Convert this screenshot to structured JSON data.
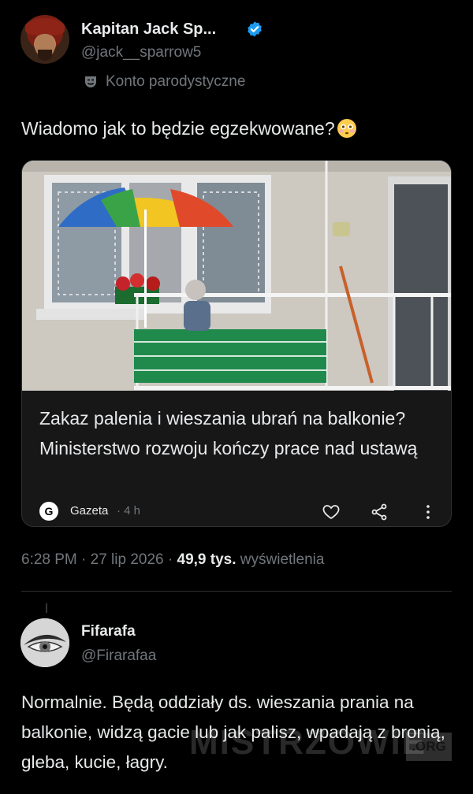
{
  "tweet": {
    "author_name": "Kapitan Jack Sp...",
    "author_handle": "@jack__sparrow5",
    "parody_label": "Konto parodystyczne",
    "text": "Wiadomo jak to będzie egzekwowane?",
    "emoji": "flushed-face-emoji",
    "timestamp": "6:28 PM · 27 lip 2026 · ",
    "views_count": "49,9 tys.",
    "views_label": " wyświetlenia"
  },
  "card": {
    "title": "Zakaz palenia i wieszania ubrań na balkonie? Ministerstwo rozwoju kończy prace nad ustawą",
    "source_logo": "G",
    "source_name": "Gazeta",
    "source_time": " · 4 h",
    "icons": [
      "heart-icon",
      "share-icon",
      "more-icon"
    ]
  },
  "reply": {
    "author_name": "Fifarafa",
    "author_handle": "@Firarafaa",
    "text": "Normalnie. Będą oddziały ds. wieszania prania na balkonie, widzą gacie lub jak palisz, wpadają z bronią, gleba, kucie, łagry."
  },
  "watermark": {
    "text": "MISTRZOWIE",
    "suffix": ".ORG"
  },
  "colors": {
    "background": "#000000",
    "text": "#e7e9ea",
    "muted": "#71767b",
    "verified": "#1d9bf0",
    "card_bg": "#171718"
  }
}
